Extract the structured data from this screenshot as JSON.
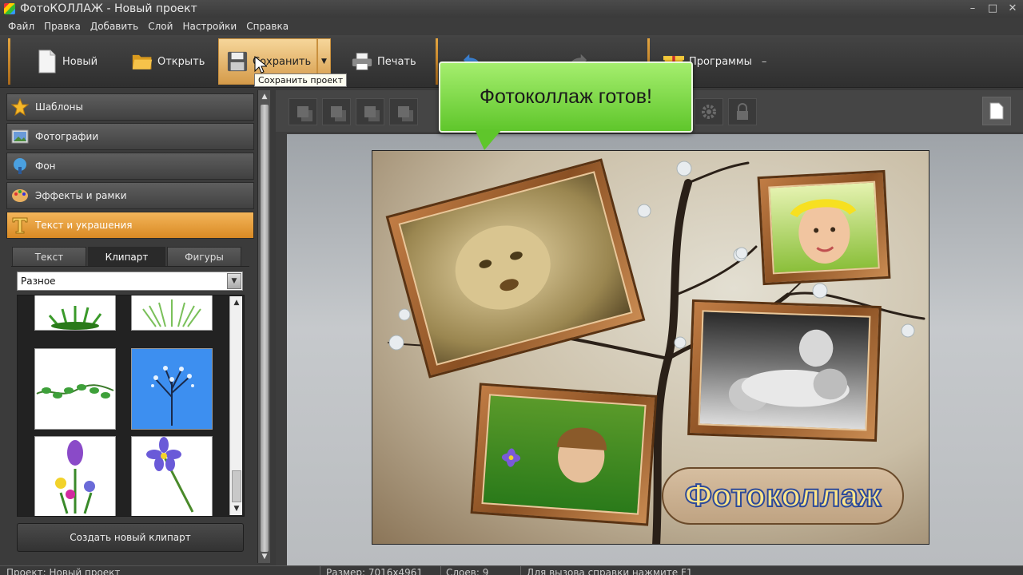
{
  "window": {
    "title": "ФотоКОЛЛАЖ - Новый проект",
    "min": "–",
    "max": "□",
    "close": "✕"
  },
  "menu": [
    "Файл",
    "Правка",
    "Добавить",
    "Слой",
    "Настройки",
    "Справка"
  ],
  "toolbar": {
    "new_label": "Новый",
    "open_label": "Открыть",
    "save_label": "Сохранить",
    "save_tooltip": "Сохранить проект",
    "print_label": "Печать",
    "programs_label": "Программы",
    "accent_color": "#e5a640"
  },
  "sidebar": {
    "items": [
      {
        "label": "Шаблоны",
        "icon": "star-icon"
      },
      {
        "label": "Фотографии",
        "icon": "photos-icon"
      },
      {
        "label": "Фон",
        "icon": "paint-icon"
      },
      {
        "label": "Эффекты и рамки",
        "icon": "palette-icon"
      },
      {
        "label": "Текст и украшения",
        "icon": "text-icon",
        "active": true
      }
    ],
    "tabs": [
      "Текст",
      "Клипарт",
      "Фигуры"
    ],
    "active_tab": "Клипарт",
    "category": "Разное",
    "create_clipart_label": "Создать новый клипарт"
  },
  "canvas": {
    "banner": "Фотоколлаж готов!",
    "collage_title": "Фотоколлаж"
  },
  "status": {
    "project": "Проект: Новый проект",
    "size": "Размер: 7016x4961",
    "layers": "Слоев: 9",
    "help": "Для вызова справки нажмите F1"
  }
}
